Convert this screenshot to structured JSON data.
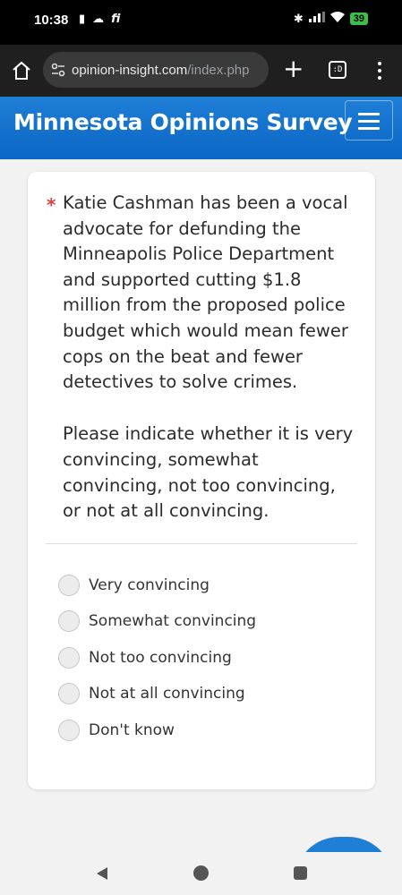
{
  "status_bar": {
    "time": "10:38",
    "carrier": "fi",
    "battery": "39"
  },
  "browser": {
    "url_domain": "opinion-insight.com",
    "url_path": "/index.php",
    "tabs_label": ":D"
  },
  "header": {
    "title": "Minnesota Opinions Survey"
  },
  "question": {
    "required_mark": "*",
    "text": "Katie Cashman has been a vocal advocate for defunding the Minneapolis Police Department and supported cutting $1.8 million from the proposed police budget which would mean fewer cops on the beat and fewer detectives to solve crimes.",
    "instruction": "Please indicate whether it is very convincing, somewhat convincing, not too convincing, or not at all convincing."
  },
  "options": [
    {
      "label": "Very convincing"
    },
    {
      "label": "Somewhat convincing"
    },
    {
      "label": "Not too convincing"
    },
    {
      "label": "Not at all convincing"
    },
    {
      "label": "Don't know"
    }
  ],
  "colors": {
    "header_blue": "#1f7ed6",
    "required_red": "#e0403d",
    "battery_green": "#3dbd4a"
  },
  "icons": [
    "home-icon",
    "site-settings-icon",
    "plus-icon",
    "tabs-icon",
    "more-vert-icon",
    "hamburger-icon",
    "back-icon",
    "home-nav-icon",
    "recents-icon"
  ]
}
